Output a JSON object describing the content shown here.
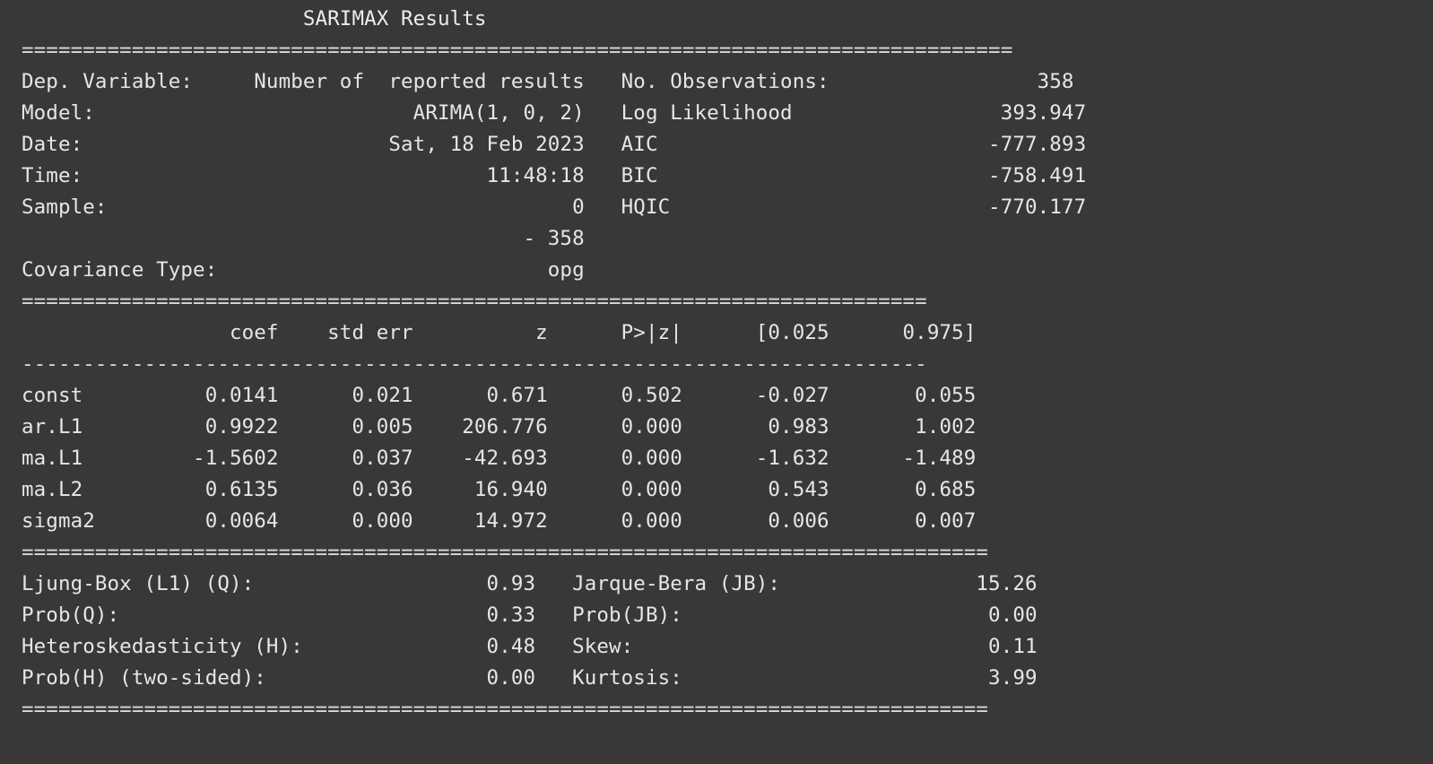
{
  "output": {
    "lines": [
      "                       SARIMAX Results                                   ",
      "=================================================================================",
      "Dep. Variable:     Number of  reported results   No. Observations:                 358",
      "Model:                          ARIMA(1, 0, 2)   Log Likelihood                 393.947",
      "Date:                         Sat, 18 Feb 2023   AIC                           -777.893",
      "Time:                                 11:48:18   BIC                           -758.491",
      "Sample:                                      0   HQIC                          -770.177",
      "                                         - 358",
      "Covariance Type:                           opg",
      "==========================================================================",
      "                 coef    std err          z      P>|z|      [0.025      0.975]",
      "--------------------------------------------------------------------------",
      "const          0.0141      0.021      0.671      0.502      -0.027       0.055",
      "ar.L1          0.9922      0.005    206.776      0.000       0.983       1.002",
      "ma.L1         -1.5602      0.037    -42.693      0.000      -1.632      -1.489",
      "ma.L2          0.6135      0.036     16.940      0.000       0.543       0.685",
      "sigma2         0.0064      0.000     14.972      0.000       0.006       0.007",
      "===============================================================================",
      "Ljung-Box (L1) (Q):                   0.93   Jarque-Bera (JB):                15.26",
      "Prob(Q):                              0.33   Prob(JB):                         0.00",
      "Heteroskedasticity (H):               0.48   Skew:                             0.11",
      "Prob(H) (two-sided):                  0.00   Kurtosis:                         3.99",
      "==============================================================================="
    ]
  }
}
